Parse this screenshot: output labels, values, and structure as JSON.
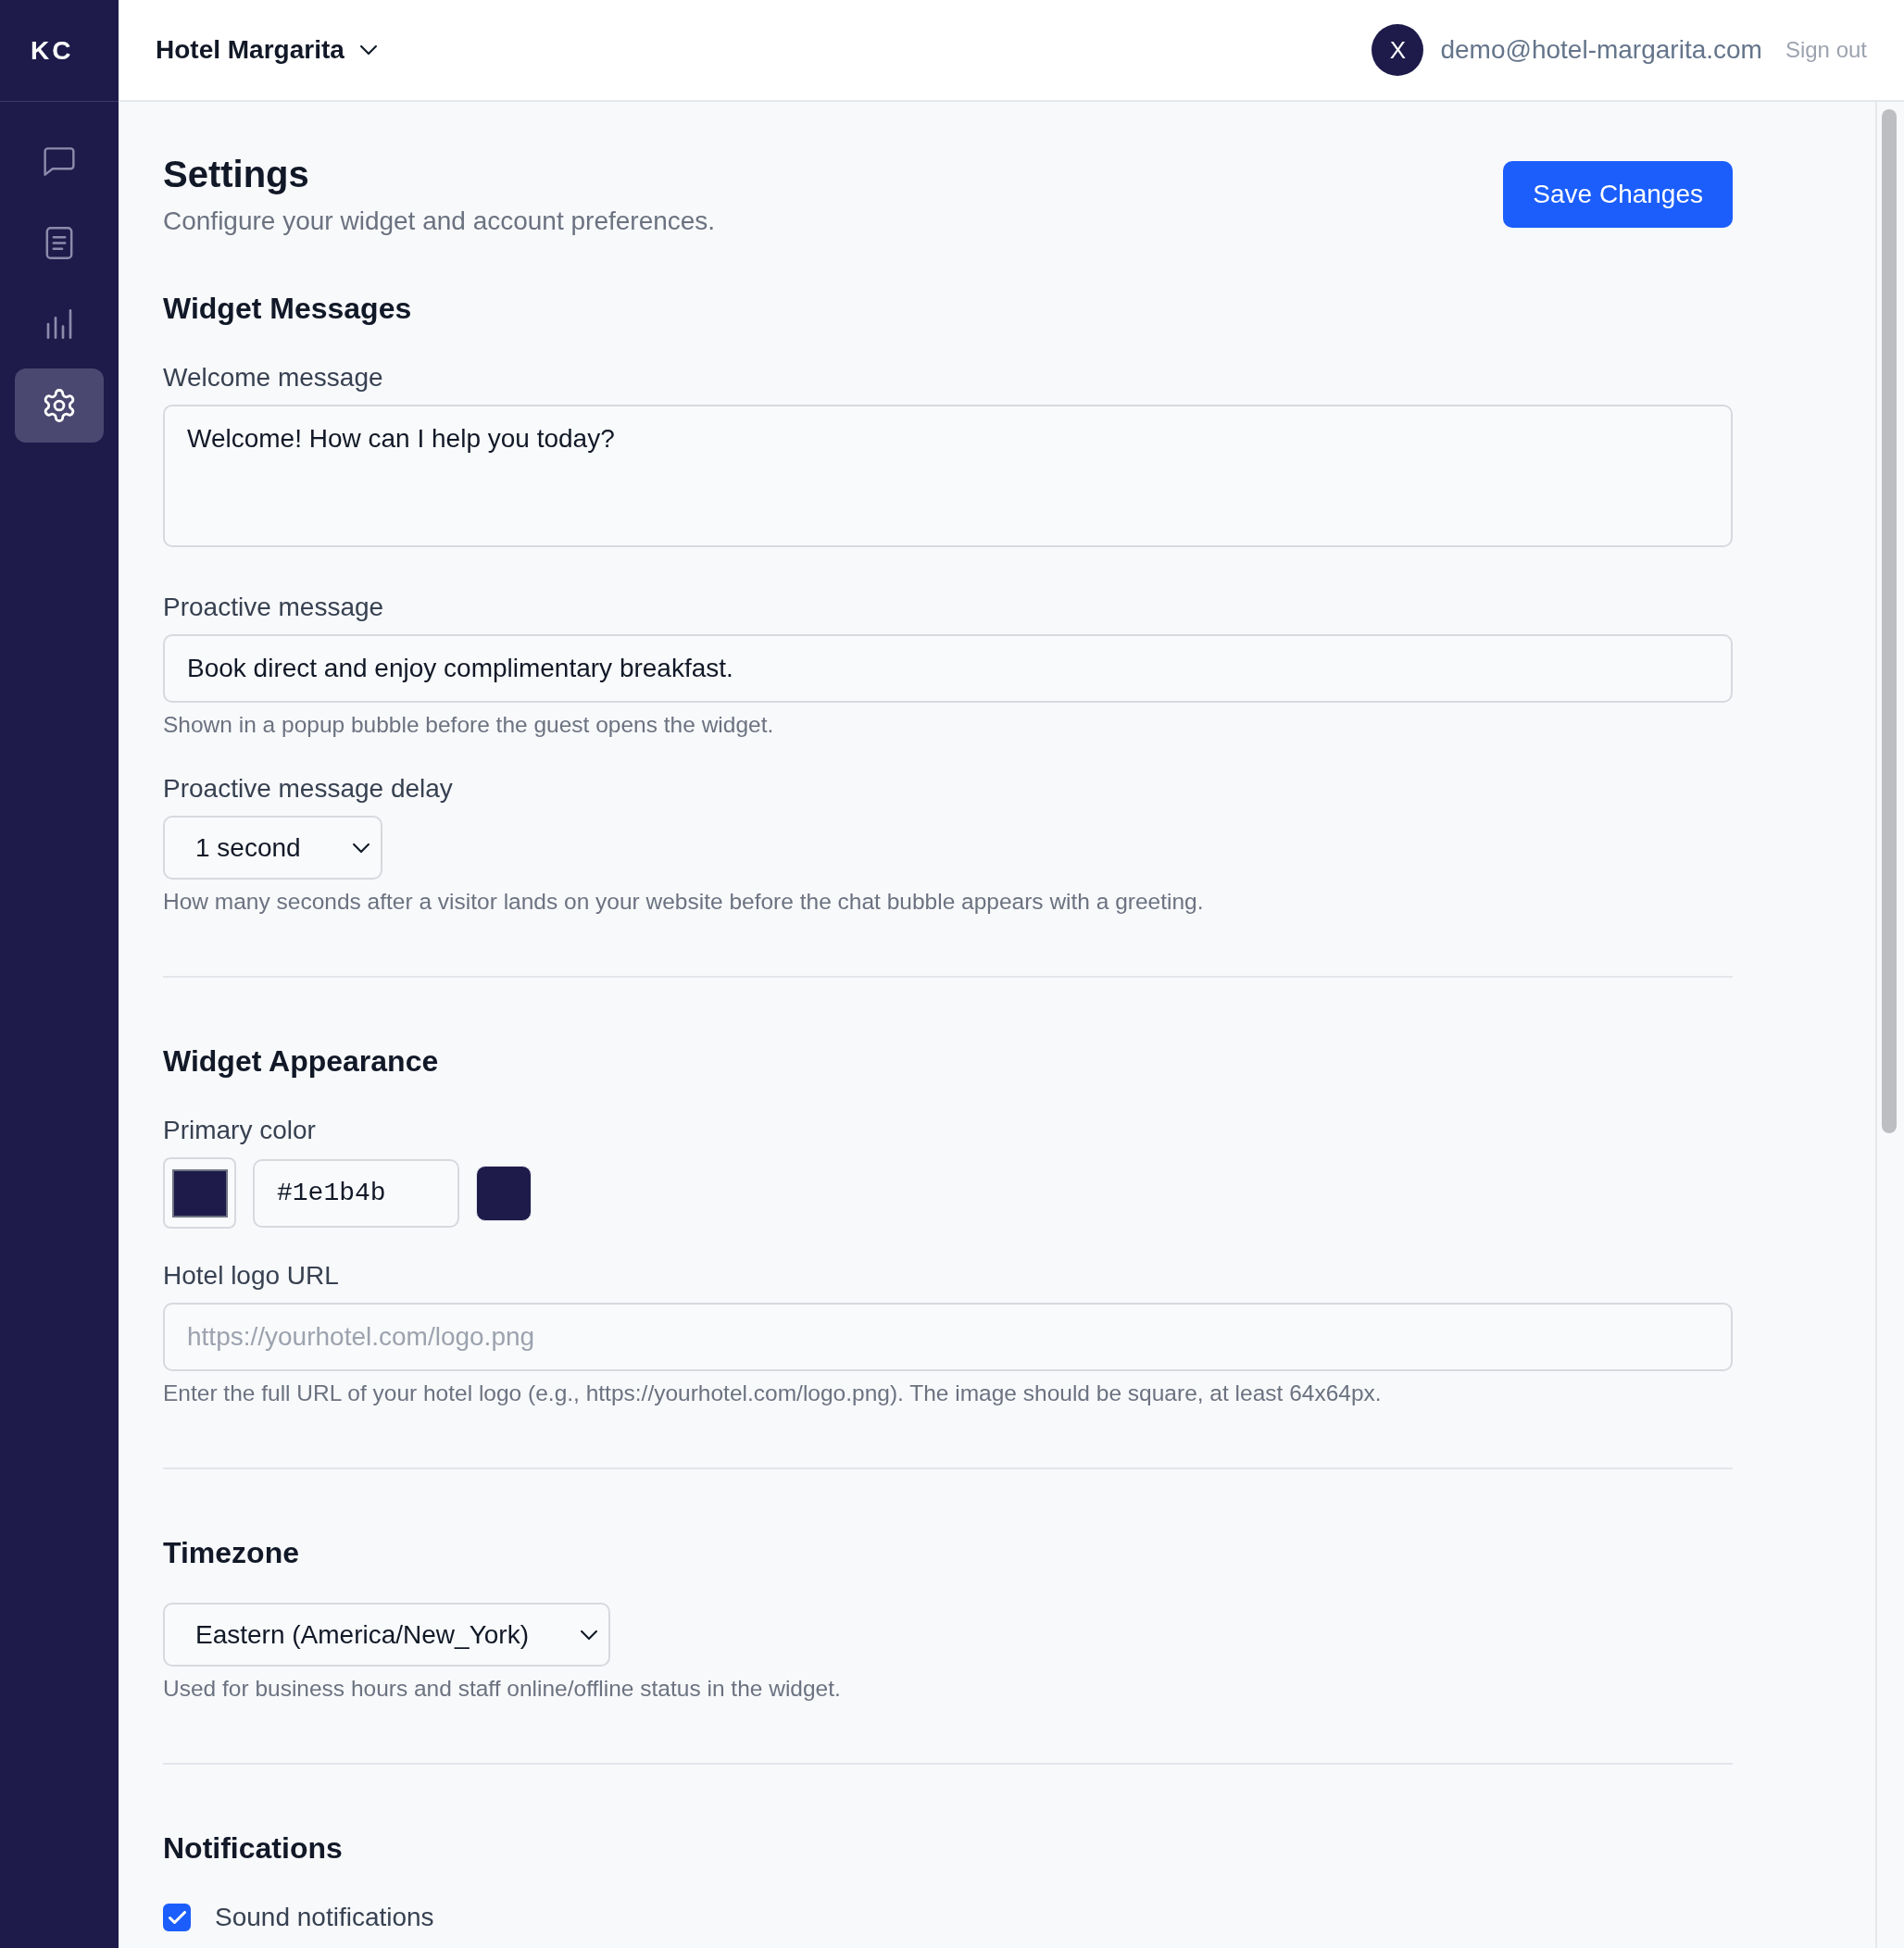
{
  "sidebar": {
    "logo": "KC",
    "items": [
      {
        "selected": false
      },
      {
        "selected": false
      },
      {
        "selected": false
      },
      {
        "selected": true
      }
    ]
  },
  "header": {
    "hotel": "Hotel Margarita",
    "avatar_initial": "X",
    "email": "demo@hotel-margarita.com",
    "sign_out": "Sign out"
  },
  "page": {
    "title": "Settings",
    "subtitle": "Configure your widget and account preferences.",
    "save_button": "Save Changes"
  },
  "sections": [
    {
      "heading": "Widget Messages",
      "fields": [
        {
          "kind": "textarea",
          "label": "Welcome message",
          "value": "Welcome! How can I help you today?"
        },
        {
          "kind": "text",
          "label": "Proactive message",
          "value": "Book direct and enjoy complimentary breakfast.",
          "help": "Shown in a popup bubble before the guest opens the widget."
        },
        {
          "kind": "select",
          "label": "Proactive message delay",
          "value": "1 second",
          "help": "How many seconds after a visitor lands on your website before the chat bubble appears with a greeting."
        }
      ]
    },
    {
      "heading": "Widget Appearance",
      "fields": [
        {
          "kind": "color",
          "label": "Primary color",
          "value": "#1e1b4b",
          "color": "#1e1b4b"
        },
        {
          "kind": "text",
          "label": "Hotel logo URL",
          "placeholder": "https://yourhotel.com/logo.png",
          "help": "Enter the full URL of your hotel logo (e.g., https://yourhotel.com/logo.png). The image should be square, at least 64x64px."
        }
      ]
    },
    {
      "heading": "Timezone",
      "fields": [
        {
          "kind": "select",
          "value": "Eastern (America/New_York)",
          "help": "Used for business hours and staff online/offline status in the widget."
        }
      ]
    },
    {
      "heading": "Notifications",
      "fields": [
        {
          "kind": "checkbox",
          "label": "Sound notifications",
          "checked": true
        }
      ]
    }
  ]
}
